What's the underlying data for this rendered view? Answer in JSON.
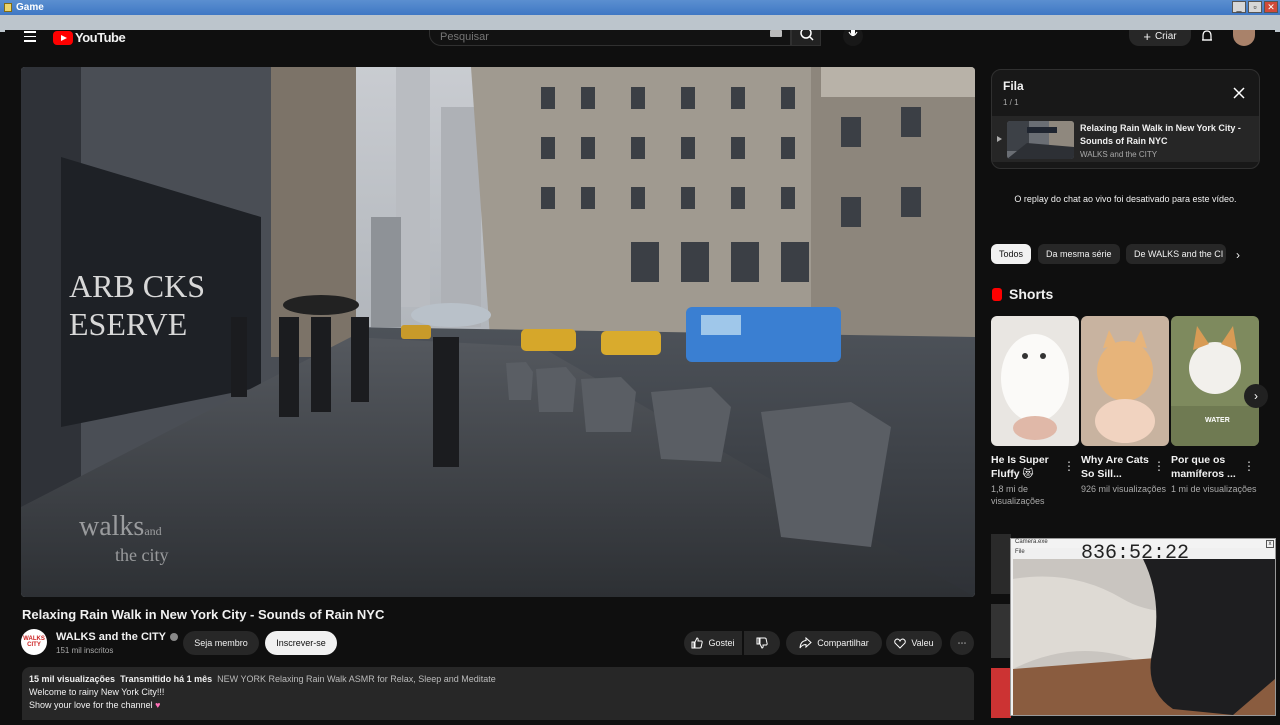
{
  "os": {
    "window_title": "Game",
    "btn_min": "_",
    "btn_max": "▫",
    "btn_close": "✕"
  },
  "header": {
    "logo_text": "YouTube",
    "search_placeholder": "Pesquisar",
    "create_label": "Criar"
  },
  "video": {
    "title": "Relaxing Rain Walk in New York City - Sounds of Rain NYC",
    "watermark_line1": "walks",
    "watermark_line2": "the city",
    "watermark_and": "and"
  },
  "channel": {
    "name": "WALKS and the CITY",
    "subscribers": "151 mil inscritos",
    "avatar_text": "WALKS CITY",
    "join_label": "Seja membro",
    "subscribe_label": "Inscrever-se"
  },
  "actions": {
    "like_label": "Gostei",
    "share_label": "Compartilhar",
    "thanks_label": "Valeu",
    "more": "⋯"
  },
  "description": {
    "views": "15 mil visualizações",
    "posted": "Transmitido há 1 mês",
    "tags": "NEW YORK Relaxing Rain Walk",
    "tags2": "ASMR for Relax, Sleep and Meditate",
    "line2": "Welcome to rainy New York City!!!",
    "line3": "Show your love for the channel"
  },
  "queue": {
    "title": "Fila",
    "count": "1 / 1",
    "item_title": "Relaxing Rain Walk in New York City - Sounds of Rain NYC",
    "item_channel": "WALKS and the CITY",
    "close": "✕"
  },
  "chat": {
    "disabled_text": "O replay do chat ao vivo foi desativado para este vídeo."
  },
  "chips": {
    "all": "Todos",
    "series": "Da mesma série",
    "channel": "De WALKS and the CI",
    "next": "›"
  },
  "shorts": {
    "heading": "Shorts",
    "next": "›",
    "items": [
      {
        "title": "He Is Super Fluffy 😻",
        "views": "1,8 mi de visualizações"
      },
      {
        "title": "Why Are Cats So Sill...",
        "views": "926 mil visualizações"
      },
      {
        "title": "Por que os mamíferos ...",
        "views": "1 mi de visualizações"
      }
    ]
  },
  "camera_overlay": {
    "window_title": "Camera.exe",
    "time": "836:52:22",
    "menu": "File",
    "close": "x"
  },
  "colors": {
    "background": "#0f0f0f",
    "brand_red": "#ff0000",
    "chip_dark": "#272727",
    "text_primary": "#f1f1f1",
    "text_secondary": "#aaaaaa"
  }
}
